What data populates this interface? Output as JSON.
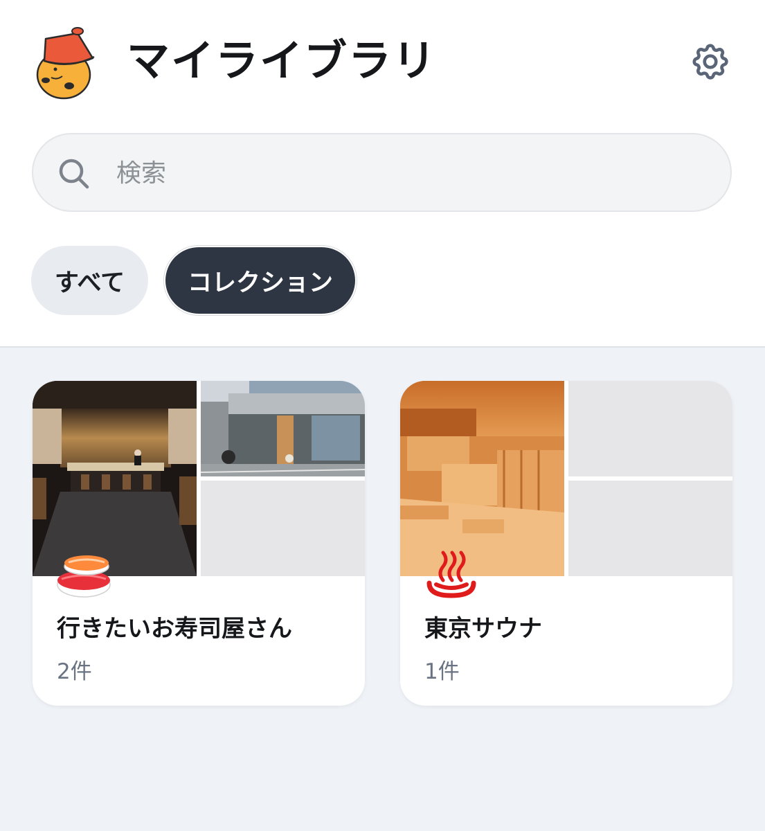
{
  "header": {
    "title": "マイライブラリ",
    "avatar_icon": "mascot-avatar-icon",
    "settings_icon": "gear-icon"
  },
  "search": {
    "placeholder": "検索",
    "value": "",
    "icon": "search-icon"
  },
  "filters": [
    {
      "label": "すべて",
      "selected": false
    },
    {
      "label": "コレクション",
      "selected": true
    }
  ],
  "collections": [
    {
      "emoji_icon": "sushi-icon",
      "title": "行きたいお寿司屋さん",
      "count": "2件",
      "thumbnails": [
        "sushi-restaurant-interior",
        "restaurant-building-exterior",
        "empty"
      ]
    },
    {
      "emoji_icon": "hot-springs-icon",
      "title": "東京サウナ",
      "count": "1件",
      "thumbnails": [
        "sauna-wooden-interior",
        "empty",
        "empty"
      ]
    }
  ],
  "colors": {
    "accent_dark": "#2f3643",
    "background": "#eff3f7",
    "chip_light": "#e8ecf0",
    "muted_text": "#6a7381"
  }
}
